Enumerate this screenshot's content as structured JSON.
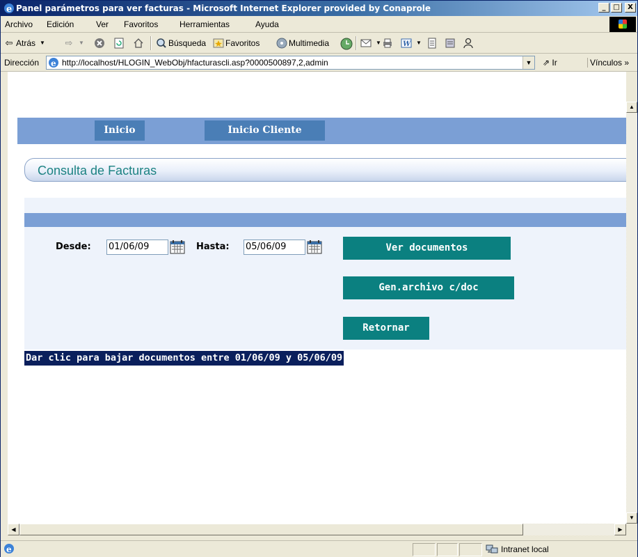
{
  "window": {
    "title": "Panel parámetros para ver facturas - Microsoft Internet Explorer provided by Conaprole",
    "buttons": {
      "minimize": "_",
      "maximize": "□",
      "close": "X"
    }
  },
  "menu": [
    "Archivo",
    "Edición",
    "Ver",
    "Favoritos",
    "Herramientas",
    "Ayuda"
  ],
  "toolbar": {
    "back": "Atrás",
    "search": "Búsqueda",
    "favorites": "Favoritos",
    "multimedia": "Multimedia"
  },
  "address": {
    "label": "Dirección",
    "url": "http://localhost/HLOGIN_WebObj/hfacturascli.asp?0000500897,2,admin",
    "go": "Ir",
    "links": "Vínculos »"
  },
  "nav": {
    "inicio": "Inicio",
    "inicio_cliente": "Inicio Cliente"
  },
  "section_title": "Consulta de Facturas",
  "form": {
    "desde_label": "Desde:",
    "desde_value": "01/06/09",
    "hasta_label": "Hasta:",
    "hasta_value": "05/06/09",
    "ver_documentos": "Ver documentos",
    "gen_archivo": "Gen.archivo c/doc",
    "retornar": "Retornar"
  },
  "download_link": "Dar clic para bajar documentos entre 01/06/09 y 05/06/09",
  "status": {
    "zone": "Intranet local"
  },
  "colors": {
    "nav_band": "#7b9fd5",
    "nav_button": "#4a7eb6",
    "action_button": "#0b8080",
    "title_text": "#1c8282",
    "link_highlight": "#0a1f5c"
  }
}
